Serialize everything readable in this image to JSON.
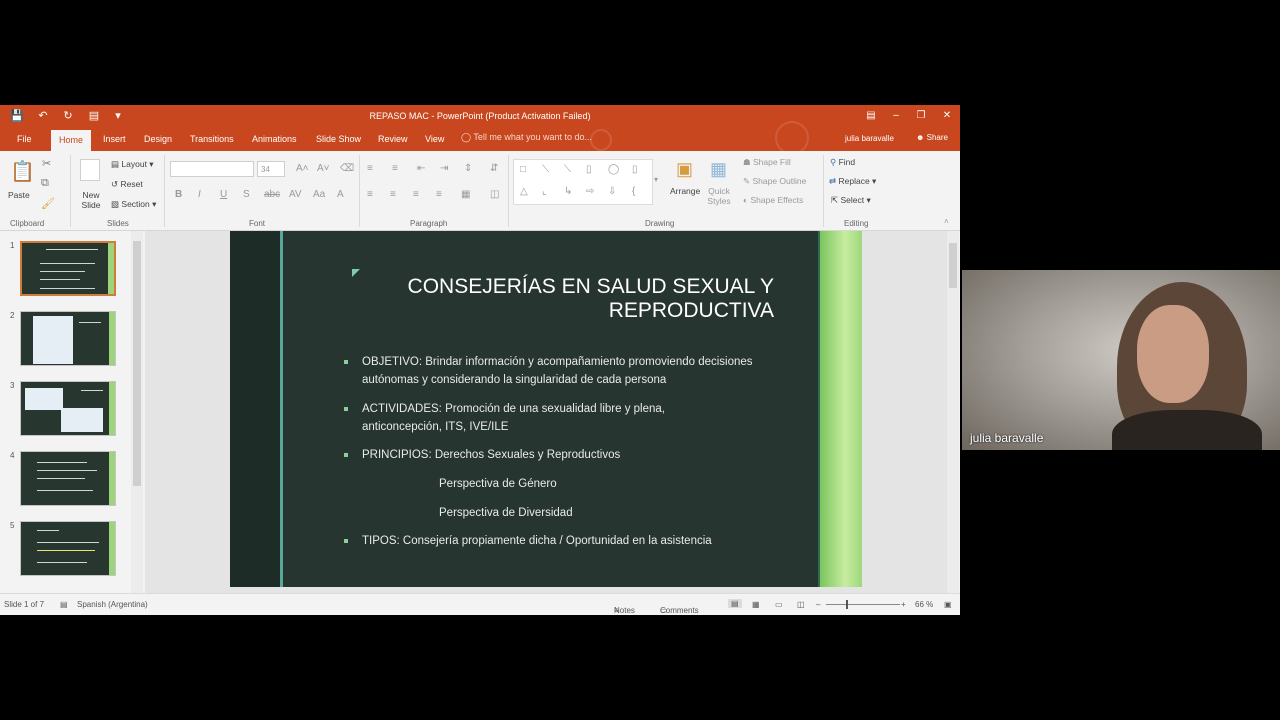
{
  "window": {
    "title": "REPASO MAC - PowerPoint (Product Activation Failed)"
  },
  "tabs": [
    "File",
    "Home",
    "Insert",
    "Design",
    "Transitions",
    "Animations",
    "Slide Show",
    "Review",
    "View"
  ],
  "tell_me": "Tell me what you want to do...",
  "user": "julia baravalle",
  "share": "Share",
  "ribbon": {
    "clipboard": {
      "paste": "Paste",
      "label": "Clipboard"
    },
    "slides": {
      "new_slide": "New Slide",
      "layout": "Layout",
      "reset": "Reset",
      "section": "Section",
      "label": "Slides"
    },
    "font": {
      "size": "34",
      "label": "Font"
    },
    "paragraph": {
      "label": "Paragraph"
    },
    "drawing": {
      "arrange": "Arrange",
      "quick_styles": "Quick Styles",
      "shape_fill": "Shape Fill",
      "shape_outline": "Shape Outline",
      "shape_effects": "Shape Effects",
      "label": "Drawing"
    },
    "editing": {
      "find": "Find",
      "replace": "Replace",
      "select": "Select",
      "label": "Editing"
    }
  },
  "thumbnails": [
    "1",
    "2",
    "3",
    "4",
    "5"
  ],
  "slide": {
    "title": "CONSEJERÍAS EN SALUD SEXUAL Y REPRODUCTIVA",
    "bullets": [
      "OBJETIVO: Brindar información y acompañamiento promoviendo decisiones autónomas y considerando la singularidad de cada persona",
      "ACTIVIDADES: Promoción de una sexualidad libre y plena, anticoncepción, ITS, IVE/ILE",
      "PRINCIPIOS: Derechos Sexuales y Reproductivos",
      "TIPOS: Consejería propiamente dicha / Oportunidad en la asistencia"
    ],
    "sub_items": [
      "Perspectiva de Género",
      "Perspectiva de Diversidad"
    ]
  },
  "status": {
    "slide_counter": "Slide 1 of 7",
    "language": "Spanish (Argentina)",
    "notes": "Notes",
    "comments": "Comments",
    "zoom": "66 %"
  },
  "webcam": {
    "name": "julia baravalle"
  }
}
